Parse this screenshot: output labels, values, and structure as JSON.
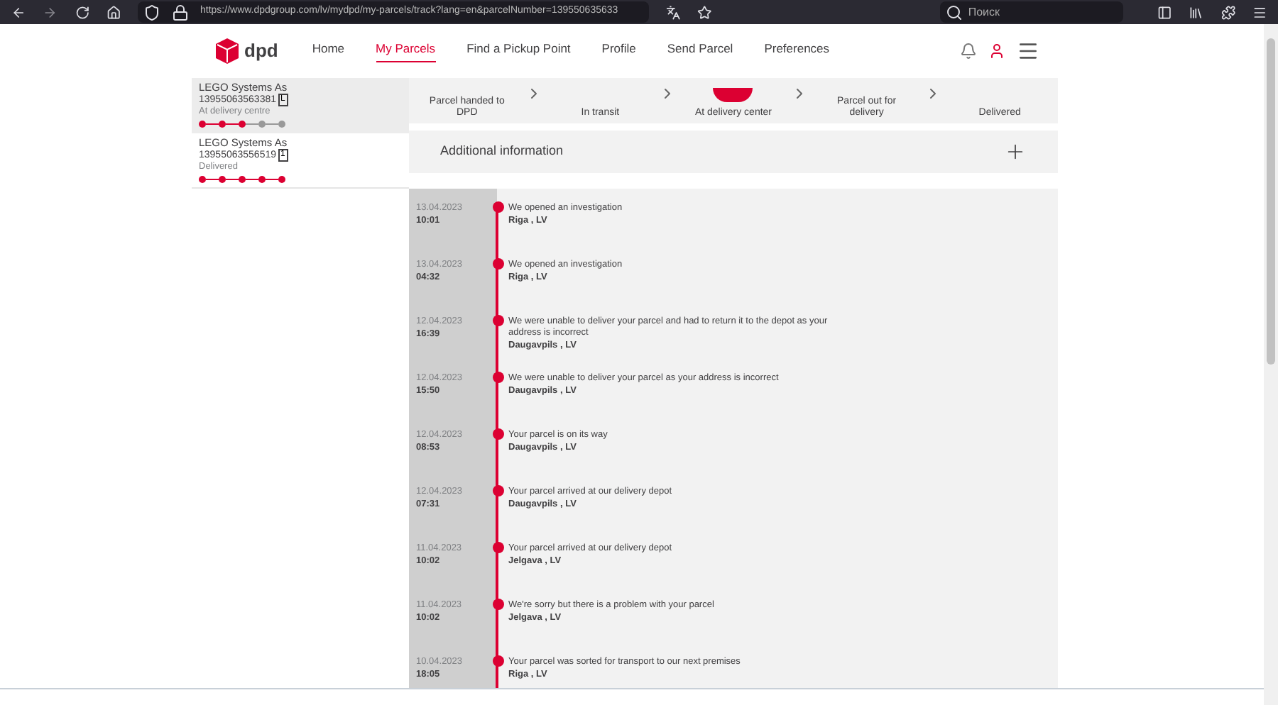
{
  "browser": {
    "url": "https://www.dpdgroup.com/lv/mydpd/my-parcels/track?lang=en&parcelNumber=139550635633",
    "search_placeholder": "Поиск"
  },
  "nav": {
    "logo": "dpd",
    "items": [
      {
        "label": "Home",
        "selected": false
      },
      {
        "label": "My Parcels",
        "selected": true
      },
      {
        "label": "Find a Pickup Point",
        "selected": false
      },
      {
        "label": "Profile",
        "selected": false
      },
      {
        "label": "Send Parcel",
        "selected": false
      },
      {
        "label": "Preferences",
        "selected": false
      }
    ]
  },
  "parcels": [
    {
      "sender": "LEGO Systems As",
      "number": "13955063563381",
      "count": "L",
      "status": "At delivery centre",
      "selected": true,
      "dots": [
        true,
        true,
        true,
        false,
        false
      ]
    },
    {
      "sender": "LEGO Systems As",
      "number": "13955063556519",
      "count": "1",
      "status": "Delivered",
      "selected": false,
      "dots": [
        true,
        true,
        true,
        true,
        true
      ]
    }
  ],
  "steps": [
    {
      "label": "Parcel handed to DPD",
      "active": false
    },
    {
      "label": "In transit",
      "active": false
    },
    {
      "label": "At delivery center",
      "active": true
    },
    {
      "label": "Parcel out for delivery",
      "active": false
    },
    {
      "label": "Delivered",
      "active": false
    }
  ],
  "additional_info": "Additional information",
  "events": [
    {
      "date": "13.04.2023",
      "time": "10:01",
      "text": "We opened an investigation",
      "place": "Riga , LV"
    },
    {
      "date": "13.04.2023",
      "time": "04:32",
      "text": "We opened an investigation",
      "place": "Riga , LV"
    },
    {
      "date": "12.04.2023",
      "time": "16:39",
      "text": "We were unable to deliver your parcel and had to return it to the depot as your address is incorrect",
      "place": "Daugavpils , LV"
    },
    {
      "date": "12.04.2023",
      "time": "15:50",
      "text": "We were unable to deliver your parcel as your address is incorrect",
      "place": "Daugavpils , LV"
    },
    {
      "date": "12.04.2023",
      "time": "08:53",
      "text": "Your parcel is on its way",
      "place": "Daugavpils , LV"
    },
    {
      "date": "12.04.2023",
      "time": "07:31",
      "text": "Your parcel arrived at our delivery depot",
      "place": "Daugavpils , LV"
    },
    {
      "date": "11.04.2023",
      "time": "10:02",
      "text": "Your parcel arrived at our delivery depot",
      "place": "Jelgava , LV"
    },
    {
      "date": "11.04.2023",
      "time": "10:02",
      "text": "We're sorry but there is a problem with your parcel",
      "place": "Jelgava , LV"
    },
    {
      "date": "10.04.2023",
      "time": "18:05",
      "text": "Your parcel was sorted for transport to our next premises",
      "place": "Riga , LV"
    }
  ]
}
